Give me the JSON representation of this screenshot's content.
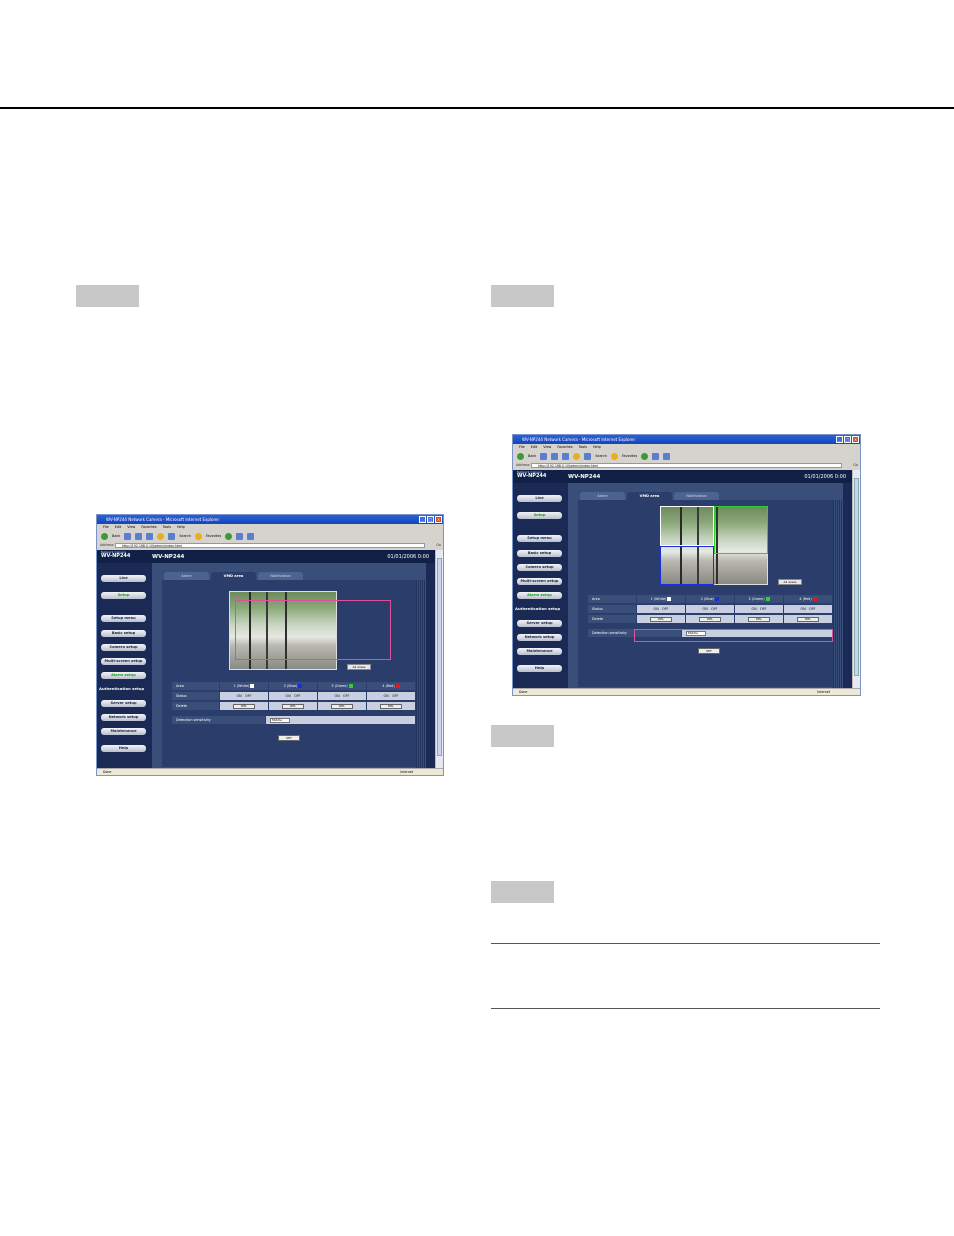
{
  "browser": {
    "window_title": "WV-NP244 Network Camera - Microsoft Internet Explorer",
    "menu": [
      "File",
      "Edit",
      "View",
      "Favorites",
      "Tools",
      "Help"
    ],
    "toolbar_back": "Back",
    "toolbar_search": "Search",
    "toolbar_favorites": "Favorites",
    "address_label": "Address",
    "address_url": "http://192.168.0.10/admin/index.html",
    "go_label": "Go",
    "status_left": "Done",
    "status_zone": "Internet"
  },
  "camera_app": {
    "subtitle": "Network Camera",
    "model": "WV-NP244",
    "model_header": "WV-NP244",
    "datetime": "01/01/2006  0:00",
    "sidebar": {
      "live": "Live",
      "setup": "Setup",
      "setup_menu": "Setup menu",
      "basic": "Basic setup",
      "camera": "Camera setup",
      "multiscreen": "Multi-screen setup",
      "alarm": "Alarm setup",
      "authentication": "Authentication setup",
      "server": "Server setup",
      "network": "Network setup",
      "maintenance": "Maintenance",
      "help": "Help"
    },
    "tabs": {
      "alarm": "Alarm",
      "vmd_area": "VMD area",
      "notification": "Notification"
    },
    "all_areas_button": "All areas",
    "table": {
      "area_label": "Area",
      "status_label": "Status",
      "delete_label": "Delete",
      "areas": [
        "1 (White)",
        "2 (Blue)",
        "3 (Green)",
        "4 (Red)"
      ],
      "on": "ON",
      "off": "OFF",
      "del": "DEL"
    },
    "detection_label": "Detection sensitivity",
    "detection_value": "Middle",
    "set_button": "SET"
  },
  "colors": {
    "white": "#ffffff",
    "blue": "#1a2ee0",
    "green": "#2fd02f",
    "red": "#e01a1a",
    "highlight": "#e0509a"
  }
}
